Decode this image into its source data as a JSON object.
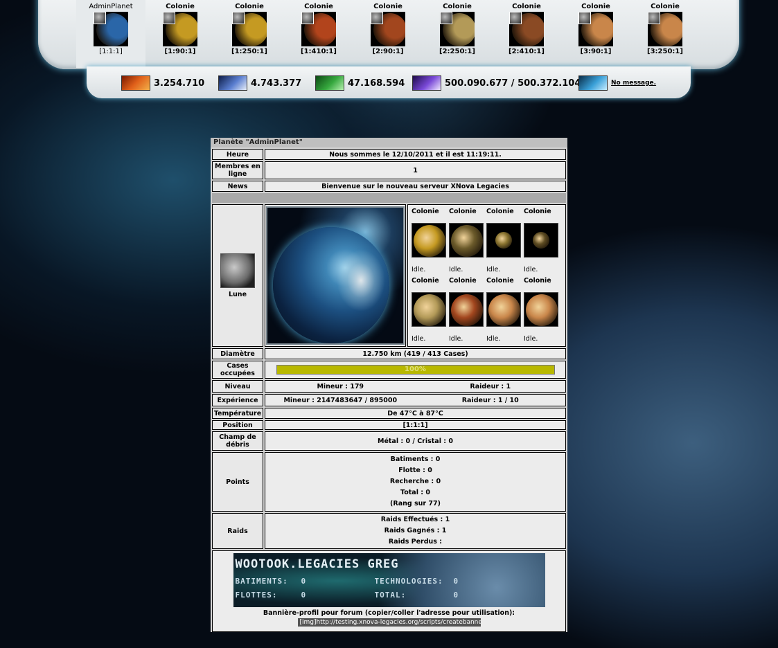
{
  "planets": [
    {
      "name": "AdminPlanet",
      "coords": "[1:1:1]",
      "color": "#2a66a8"
    },
    {
      "name": "Colonie",
      "coords": "[1:90:1]",
      "color": "#c59a22"
    },
    {
      "name": "Colonie",
      "coords": "[1:250:1]",
      "color": "#c59a22"
    },
    {
      "name": "Colonie",
      "coords": "[1:410:1]",
      "color": "#b2441c"
    },
    {
      "name": "Colonie",
      "coords": "[2:90:1]",
      "color": "#a2461e"
    },
    {
      "name": "Colonie",
      "coords": "[2:250:1]",
      "color": "#b39a58"
    },
    {
      "name": "Colonie",
      "coords": "[2:410:1]",
      "color": "#8a4a24"
    },
    {
      "name": "Colonie",
      "coords": "[3:90:1]",
      "color": "#c9864a"
    },
    {
      "name": "Colonie",
      "coords": "[3:250:1]",
      "color": "#c9864a"
    }
  ],
  "resources": {
    "metal": "3.254.710",
    "crystal": "4.743.377",
    "deuterium": "47.168.594",
    "energy": "500.090.677 / 500.372.104",
    "message": "No message."
  },
  "overview": {
    "title": "Planète \"AdminPlanet\"",
    "heure_label": "Heure",
    "heure_value": "Nous sommes le 12/10/2011 et il est 11:19:11.",
    "membres_label": "Membres en ligne",
    "membres_value": "1",
    "news_label": "News",
    "news_value": "Bienvenue sur le nouveau serveur XNova Legacies",
    "moon_label": "Lune",
    "colonies": [
      {
        "name": "Colonie",
        "status": "Idle.",
        "color": "#c59a22"
      },
      {
        "name": "Colonie",
        "status": "Idle.",
        "color": "#6b5a2a"
      },
      {
        "name": "Colonie",
        "status": "Idle.",
        "color": "#8a7430"
      },
      {
        "name": "Colonie",
        "status": "Idle.",
        "color": "#5e4c22"
      },
      {
        "name": "Colonie",
        "status": "Idle.",
        "color": "#b39a58"
      },
      {
        "name": "Colonie",
        "status": "Idle.",
        "color": "#a2461e"
      },
      {
        "name": "Colonie",
        "status": "Idle.",
        "color": "#c9864a"
      },
      {
        "name": "Colonie",
        "status": "Idle.",
        "color": "#c9864a"
      }
    ],
    "diametre_label": "Diamètre",
    "diametre_value": "12.750 km (419 / 413 Cases)",
    "cases_label": "Cases occupées",
    "cases_percent_text": "100%",
    "cases_fraction": 1.0,
    "niveau_label": "Niveau",
    "niveau_mineur": "Mineur : 179",
    "niveau_raideur": "Raideur : 1",
    "experience_label": "Expérience",
    "experience_mineur": "Mineur : 2147483647 / 895000",
    "experience_raideur": "Raideur : 1 / 10",
    "temperature_label": "Température",
    "temperature_value": "De 47°C à 87°C",
    "position_label": "Position",
    "position_value": "[1:1:1]",
    "debris_label": "Champ de débris",
    "debris_value": "Métal : 0 / Cristal : 0",
    "points_label": "Points",
    "points": {
      "batiments": "Batiments : 0",
      "flotte": "Flotte : 0",
      "recherche": "Recherche : 0",
      "total": "Total : 0",
      "rang": "(Rang sur 77)"
    },
    "raids_label": "Raids",
    "raids": {
      "effectues": "Raids Effectués : 1",
      "gagnes": "Raids Gagnés : 1",
      "perdus": "Raids Perdus :"
    },
    "banner": {
      "title": "WOOTOOK.LEGACIES   GREG",
      "batiments": "BATIMENTS:",
      "batiments_val": "0",
      "technologies": "TECHNOLOGIES:",
      "technologies_val": "0",
      "flottes": "FLOTTES:",
      "flottes_val": "0",
      "total": "TOTAL:",
      "total_val": "0",
      "caption": "Bannière-profil pour forum (copier/coller l'adresse pour utilisation):",
      "url": "[img]http://testing.xnova-legacies.org/scripts/createbanner"
    }
  }
}
